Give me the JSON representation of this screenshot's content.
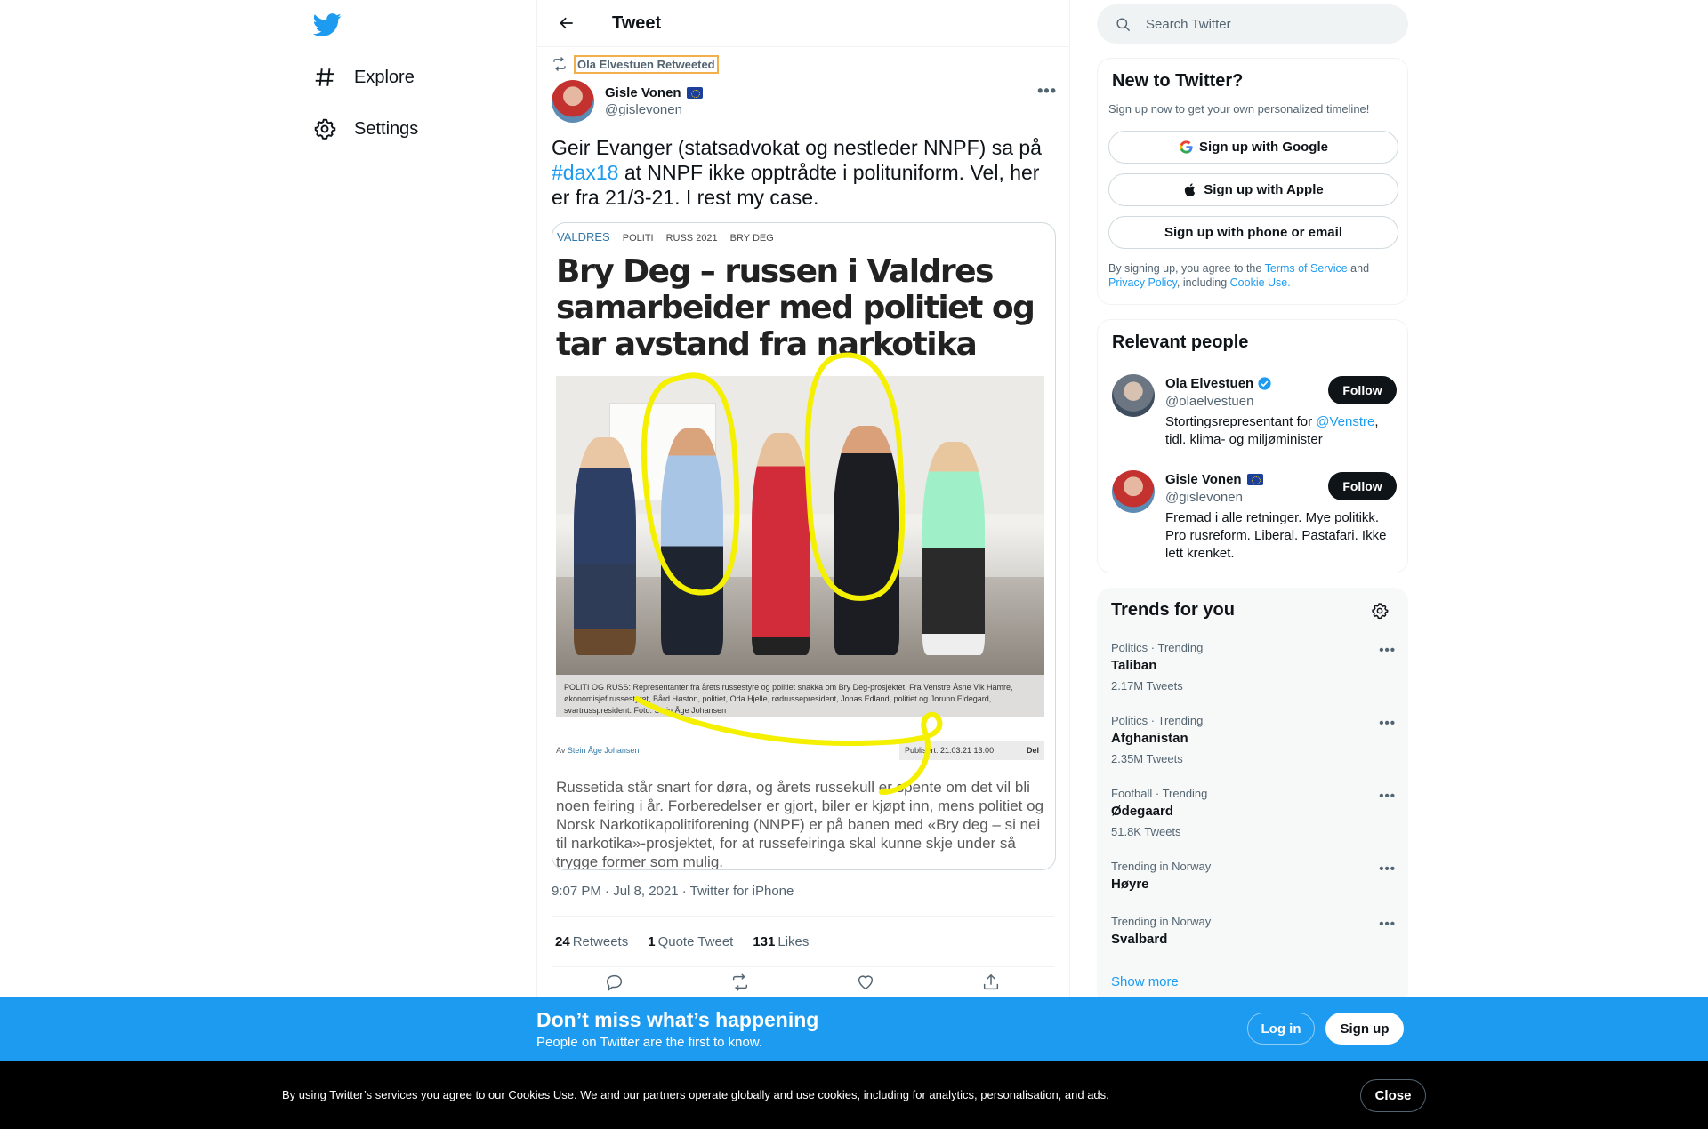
{
  "nav": {
    "items": [
      {
        "label": "Explore",
        "icon": "hashtag-icon"
      },
      {
        "label": "Settings",
        "icon": "gear-icon"
      }
    ]
  },
  "header": {
    "title": "Tweet"
  },
  "tweet": {
    "retweeted_by": "Ola Elvestuen Retweeted",
    "author_name": "Gisle Vonen",
    "author_handle": "@gislevonen",
    "text_before": "Geir Evanger (statsadvokat og nestleder NNPF) sa på ",
    "hashtag": "#dax18",
    "text_after": " at NNPF ikke opptrådte i polituniform. Vel, her er fra 21/3-21. I rest my case.",
    "timestamp": "9:07 PM · Jul 8, 2021 · Twitter for iPhone",
    "retweets_count": "24",
    "retweets_label": "Retweets",
    "quotes_count": "1",
    "quotes_label": "Quote Tweet",
    "likes_count": "131",
    "likes_label": "Likes"
  },
  "article": {
    "section": "VALDRES",
    "tags": [
      "POLITI",
      "RUSS 2021",
      "BRY DEG"
    ],
    "headline": "Bry Deg – russen i Valdres samarbeider med politiet og tar avstand fra narkotika",
    "caption": "POLITI OG RUSS: Representanter fra årets russestyre og politiet snakka om Bry Deg-prosjektet. Fra Venstre Åsne Vik Hamre, økonomisjef russestyret, Bård Høston, politiet, Oda Hjelle, rødrussepresident, Jonas Edland, politiet og Jorunn Eldegard, svartrusspresident. Foto: Stein Åge Johansen",
    "byline_prefix": "Av",
    "byline_author": "Stein Åge Johansen",
    "published": "Publisert: 21.03.21 13:00",
    "share": "Del",
    "lead": "Russetida står snart for døra, og årets russekull er spente om det vil bli noen feiring i år. Forberedelser er gjort, biler er kjøpt inn, mens politiet og Norsk Narkotikapolitiforening (NNPF) er på banen med «Bry deg – si nei til narkotika»-prosjektet, for at russefeiringa skal kunne skje under så trygge former som mulig."
  },
  "search": {
    "placeholder": "Search Twitter"
  },
  "new_to_twitter": {
    "title": "New to Twitter?",
    "subtitle": "Sign up now to get your own personalized timeline!",
    "google_label": "Sign up with Google",
    "apple_label": "Sign up with Apple",
    "phone_label": "Sign up with phone or email",
    "legal_1": "By signing up, you agree to the ",
    "terms": "Terms of Service",
    "legal_2": " and ",
    "privacy": "Privacy Policy",
    "legal_3": ", including ",
    "cookie": "Cookie Use.",
    "legal_4": ""
  },
  "relevant_people": {
    "title": "Relevant people",
    "people": [
      {
        "name": "Ola Elvestuen",
        "handle": "@olaelvestuen",
        "bio_before": "Stortingsrepresentant for ",
        "bio_link": "@Venstre",
        "bio_after": ", tidl. klima- og miljøminister",
        "follow": "Follow"
      },
      {
        "name": "Gisle Vonen",
        "handle": "@gislevonen",
        "bio_before": "Fremad i alle retninger. Mye politikk. Pro rusreform. Liberal. Pastafari. Ikke lett krenket.",
        "bio_link": "",
        "bio_after": "",
        "follow": "Follow"
      }
    ]
  },
  "trends": {
    "title": "Trends for you",
    "items": [
      {
        "meta": "Politics · Trending",
        "name": "Taliban",
        "count": "2.17M Tweets"
      },
      {
        "meta": "Politics · Trending",
        "name": "Afghanistan",
        "count": "2.35M Tweets"
      },
      {
        "meta": "Football · Trending",
        "name": "Ødegaard",
        "count": "51.8K Tweets"
      },
      {
        "meta": "Trending in Norway",
        "name": "Høyre",
        "count": ""
      },
      {
        "meta": "Trending in Norway",
        "name": "Svalbard",
        "count": ""
      }
    ],
    "show_more": "Show more"
  },
  "banner": {
    "title": "Don’t miss what’s happening",
    "subtitle": "People on Twitter are the first to know.",
    "login": "Log in",
    "signup": "Sign up"
  },
  "cookies": {
    "text": "By using Twitter’s services you agree to our Cookies Use. We and our partners operate globally and use cookies, including for analytics, personalisation, and ads.",
    "close": "Close"
  },
  "colors": {
    "accent": "#1d9bf0",
    "text": "#0f1419",
    "muted": "#536471",
    "highlight_scribble": "#f4f000"
  }
}
